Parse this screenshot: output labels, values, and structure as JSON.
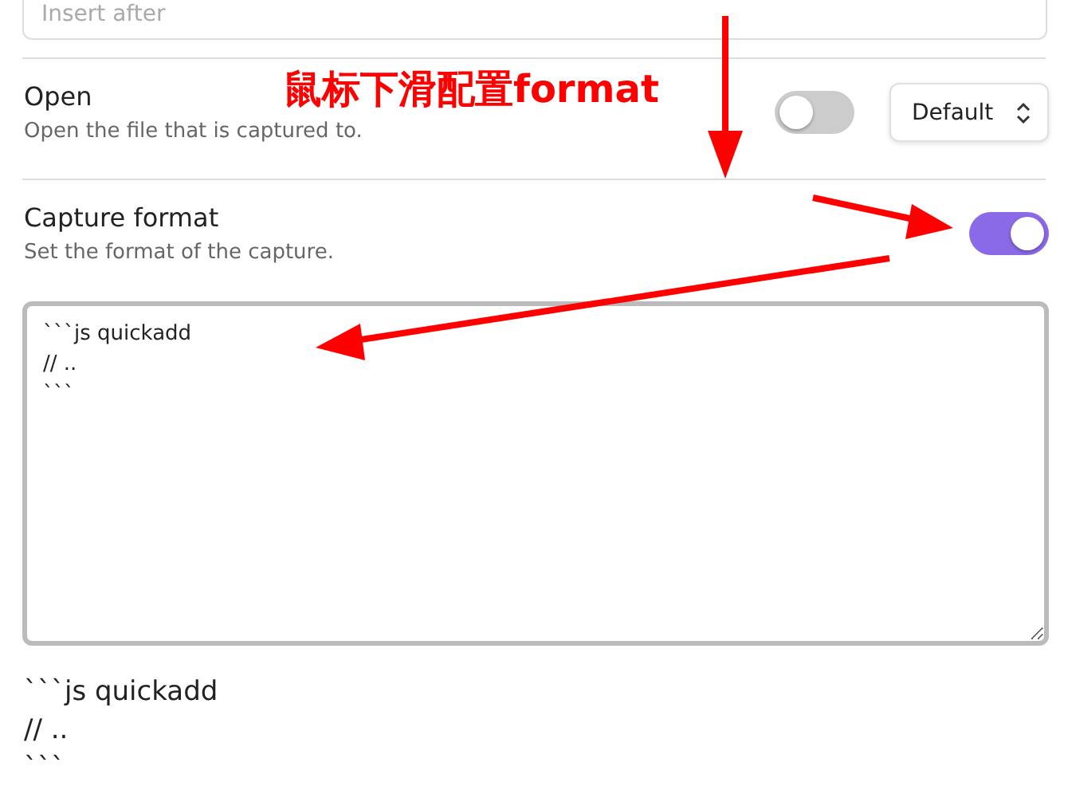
{
  "top_field": {
    "placeholder": "Insert after"
  },
  "settings": [
    {
      "kind": "toggle_dropdown",
      "name": "Open",
      "description": "Open the file that is captured to.",
      "on": false,
      "dropdown": "Default"
    },
    {
      "kind": "toggle",
      "name": "Capture format",
      "description": "Set the format of the capture.",
      "on": true
    }
  ],
  "format_editor": {
    "value": "```js quickadd\n// ..\n```"
  },
  "preview": [
    "```js quickadd",
    "// ..",
    "```"
  ],
  "annotation": {
    "text": "鼠标下滑配置format"
  }
}
